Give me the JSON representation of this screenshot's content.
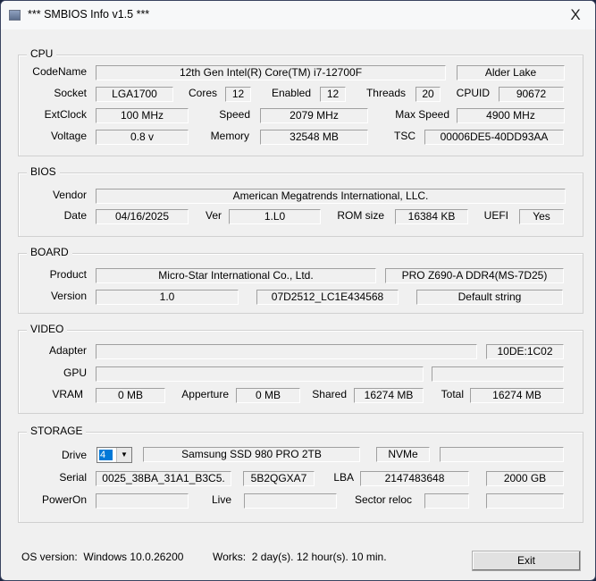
{
  "window": {
    "title": "*** SMBIOS Info v1.5 ***",
    "close": "X"
  },
  "cpu": {
    "group": "CPU",
    "labels": {
      "codename": "CodeName",
      "socket": "Socket",
      "cores": "Cores",
      "enabled": "Enabled",
      "threads": "Threads",
      "cpuid": "CPUID",
      "extclock": "ExtClock",
      "speed": "Speed",
      "maxspeed": "Max Speed",
      "voltage": "Voltage",
      "memory": "Memory",
      "tsc": "TSC"
    },
    "name": "12th Gen Intel(R) Core(TM) i7-12700F",
    "codename": "Alder Lake",
    "socket": "LGA1700",
    "cores": "12",
    "enabled": "12",
    "threads": "20",
    "cpuid": "90672",
    "extclock": "100 MHz",
    "speed": "2079 MHz",
    "maxspeed": "4900 MHz",
    "voltage": "0.8 v",
    "memory": "32548 MB",
    "tsc": "00006DE5-40DD93AA"
  },
  "bios": {
    "group": "BIOS",
    "labels": {
      "vendor": "Vendor",
      "date": "Date",
      "ver": "Ver",
      "romsize": "ROM size",
      "uefi": "UEFI"
    },
    "vendor": "American Megatrends International, LLC.",
    "date": "04/16/2025",
    "ver": "1.L0",
    "romsize": "16384 KB",
    "uefi": "Yes"
  },
  "board": {
    "group": "BOARD",
    "labels": {
      "product": "Product",
      "version": "Version"
    },
    "manufacturer": "Micro-Star International Co., Ltd.",
    "product": "PRO Z690-A DDR4(MS-7D25)",
    "version": "1.0",
    "serial": "07D2512_LC1E434568",
    "extra": "Default string"
  },
  "video": {
    "group": "VIDEO",
    "labels": {
      "adapter": "Adapter",
      "gpu": "GPU",
      "vram": "VRAM",
      "apperture": "Apperture",
      "shared": "Shared",
      "total": "Total"
    },
    "adapter": "",
    "adapter_id": "10DE:1C02",
    "gpu": "",
    "gpu_extra": "",
    "vram": "0 MB",
    "apperture": "0 MB",
    "shared": "16274 MB",
    "total": "16274 MB"
  },
  "storage": {
    "group": "STORAGE",
    "labels": {
      "drive": "Drive",
      "serial": "Serial",
      "lba": "LBA",
      "poweron": "PowerOn",
      "live": "Live",
      "sector_reloc": "Sector reloc"
    },
    "drive_selected": "4",
    "model": "Samsung SSD 980 PRO 2TB",
    "interface": "NVMe",
    "extra": "",
    "serial": "0025_38BA_31A1_B3C5.",
    "firmware": "5B2QGXA7",
    "lba": "2147483648",
    "size": "2000 GB",
    "poweron": "",
    "live": "",
    "sector_reloc": "",
    "extra2": ""
  },
  "footer": {
    "os_label": "OS version:",
    "os_value": "Windows 10.0.26200",
    "works_label": "Works:",
    "works_value": "2 day(s). 12 hour(s). 10 min.",
    "exit": "Exit"
  }
}
